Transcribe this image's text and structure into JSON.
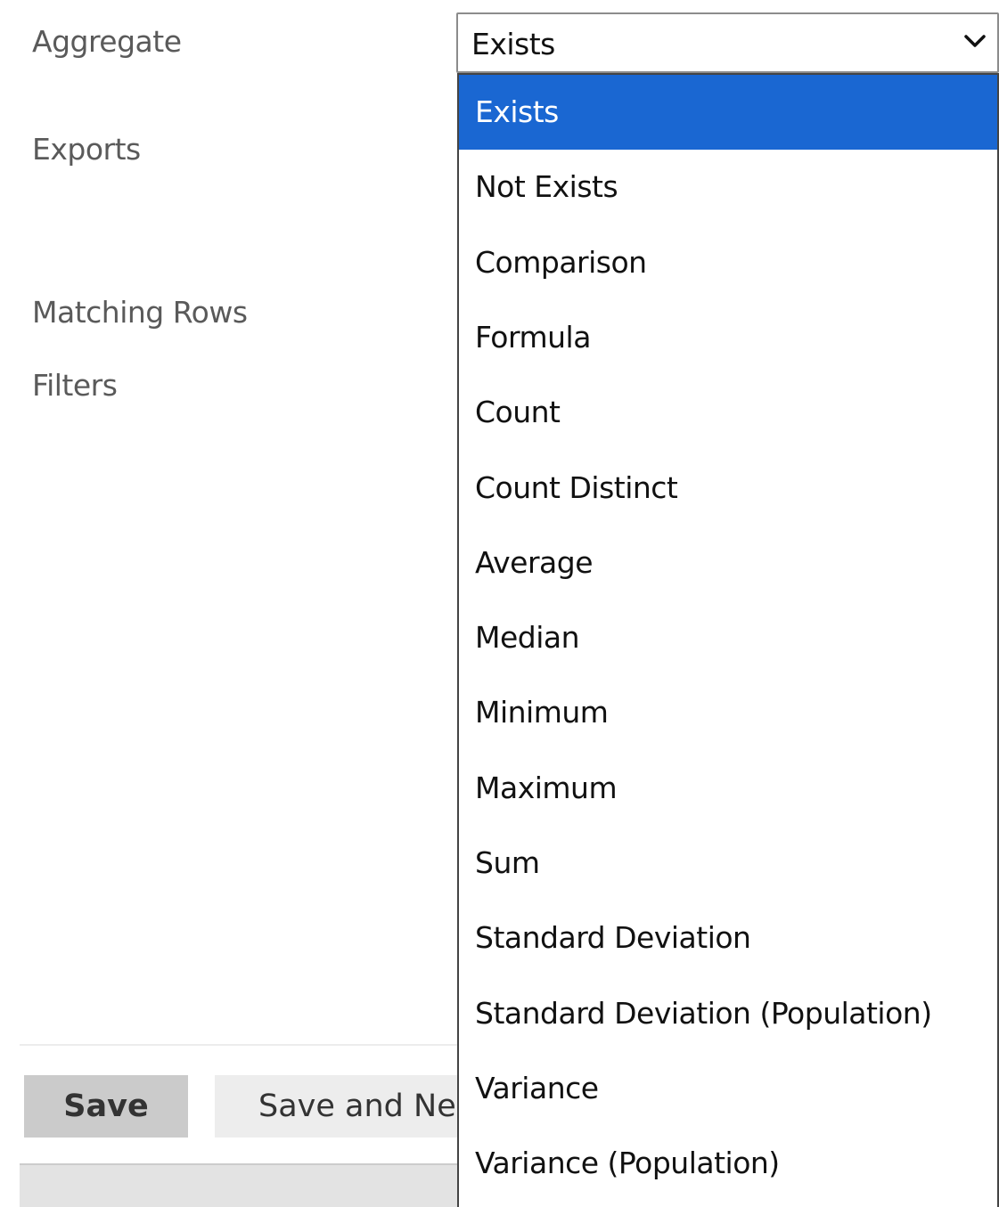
{
  "form": {
    "labels": {
      "aggregate": "Aggregate",
      "exports": "Exports",
      "matching_rows": "Matching Rows",
      "filters": "Filters"
    }
  },
  "aggregate_select": {
    "value": "Exists",
    "icon": "chevron-down-icon",
    "options": [
      "Exists",
      "Not Exists",
      "Comparison",
      "Formula",
      "Count",
      "Count Distinct",
      "Average",
      "Median",
      "Minimum",
      "Maximum",
      "Sum",
      "Standard Deviation",
      "Standard Deviation (Population)",
      "Variance",
      "Variance (Population)"
    ],
    "highlighted_index": 0,
    "highlight_color": "#1a67d2"
  },
  "buttons": {
    "save": "Save",
    "save_and_new": "Save and New"
  }
}
